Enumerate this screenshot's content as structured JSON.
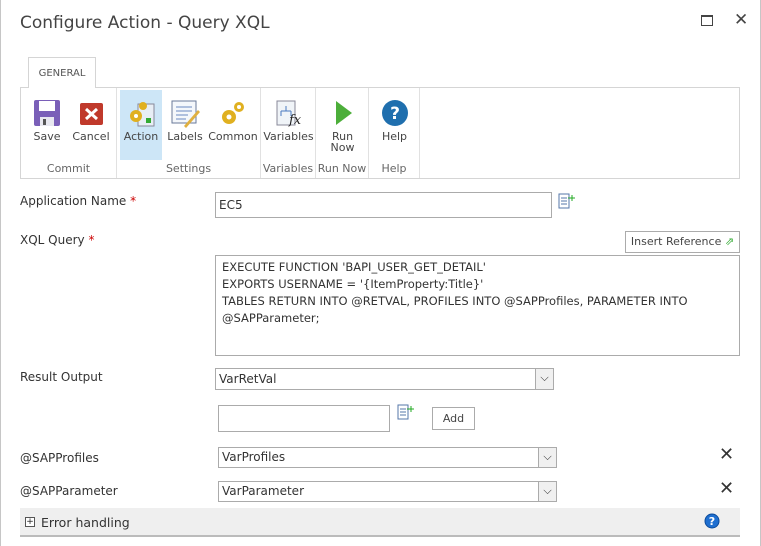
{
  "window": {
    "title": "Configure Action - Query XQL",
    "maximize_icon": "maximize-icon",
    "close_icon": "close-icon"
  },
  "ribbon": {
    "tab": "GENERAL",
    "groups": [
      {
        "label": "Commit",
        "buttons": [
          {
            "label": "Save",
            "icon": "save-icon"
          },
          {
            "label": "Cancel",
            "icon": "cancel-icon"
          }
        ]
      },
      {
        "label": "Settings",
        "buttons": [
          {
            "label": "Action",
            "icon": "action-gears-icon",
            "selected": true
          },
          {
            "label": "Labels",
            "icon": "labels-icon"
          },
          {
            "label": "Common",
            "icon": "common-gears-icon"
          }
        ]
      },
      {
        "label": "Variables",
        "buttons": [
          {
            "label": "Variables",
            "icon": "variables-fx-icon"
          }
        ]
      },
      {
        "label": "Run Now",
        "buttons": [
          {
            "label": "Run Now",
            "line1": "Run",
            "line2": "Now",
            "icon": "run-icon"
          }
        ]
      },
      {
        "label": "Help",
        "buttons": [
          {
            "label": "Help",
            "icon": "help-icon"
          }
        ]
      }
    ]
  },
  "form": {
    "application_name": {
      "label": "Application Name",
      "required": "*",
      "value": "EC5"
    },
    "xql_query": {
      "label": "XQL Query",
      "required": "*",
      "insert_reference": "Insert Reference",
      "lines": [
        "EXECUTE FUNCTION 'BAPI_USER_GET_DETAIL'",
        "EXPORTS USERNAME = '{ItemProperty:Title}'",
        "TABLES RETURN INTO @RETVAL, PROFILES INTO @SAPProfiles, PARAMETER INTO",
        "@SAPParameter;"
      ]
    },
    "result_output": {
      "label": "Result Output",
      "value": "VarRetVal"
    },
    "new_mapping": {
      "value": "",
      "add_label": "Add"
    },
    "mappings": [
      {
        "label": "@SAPProfiles",
        "value": "VarProfiles"
      },
      {
        "label": "@SAPParameter",
        "value": "VarParameter"
      }
    ],
    "error_handling": {
      "label": "Error handling",
      "expander": "+"
    }
  },
  "colors": {
    "selected": "#cde6f7",
    "required": "#cc0000",
    "section_bg": "#efefef"
  }
}
